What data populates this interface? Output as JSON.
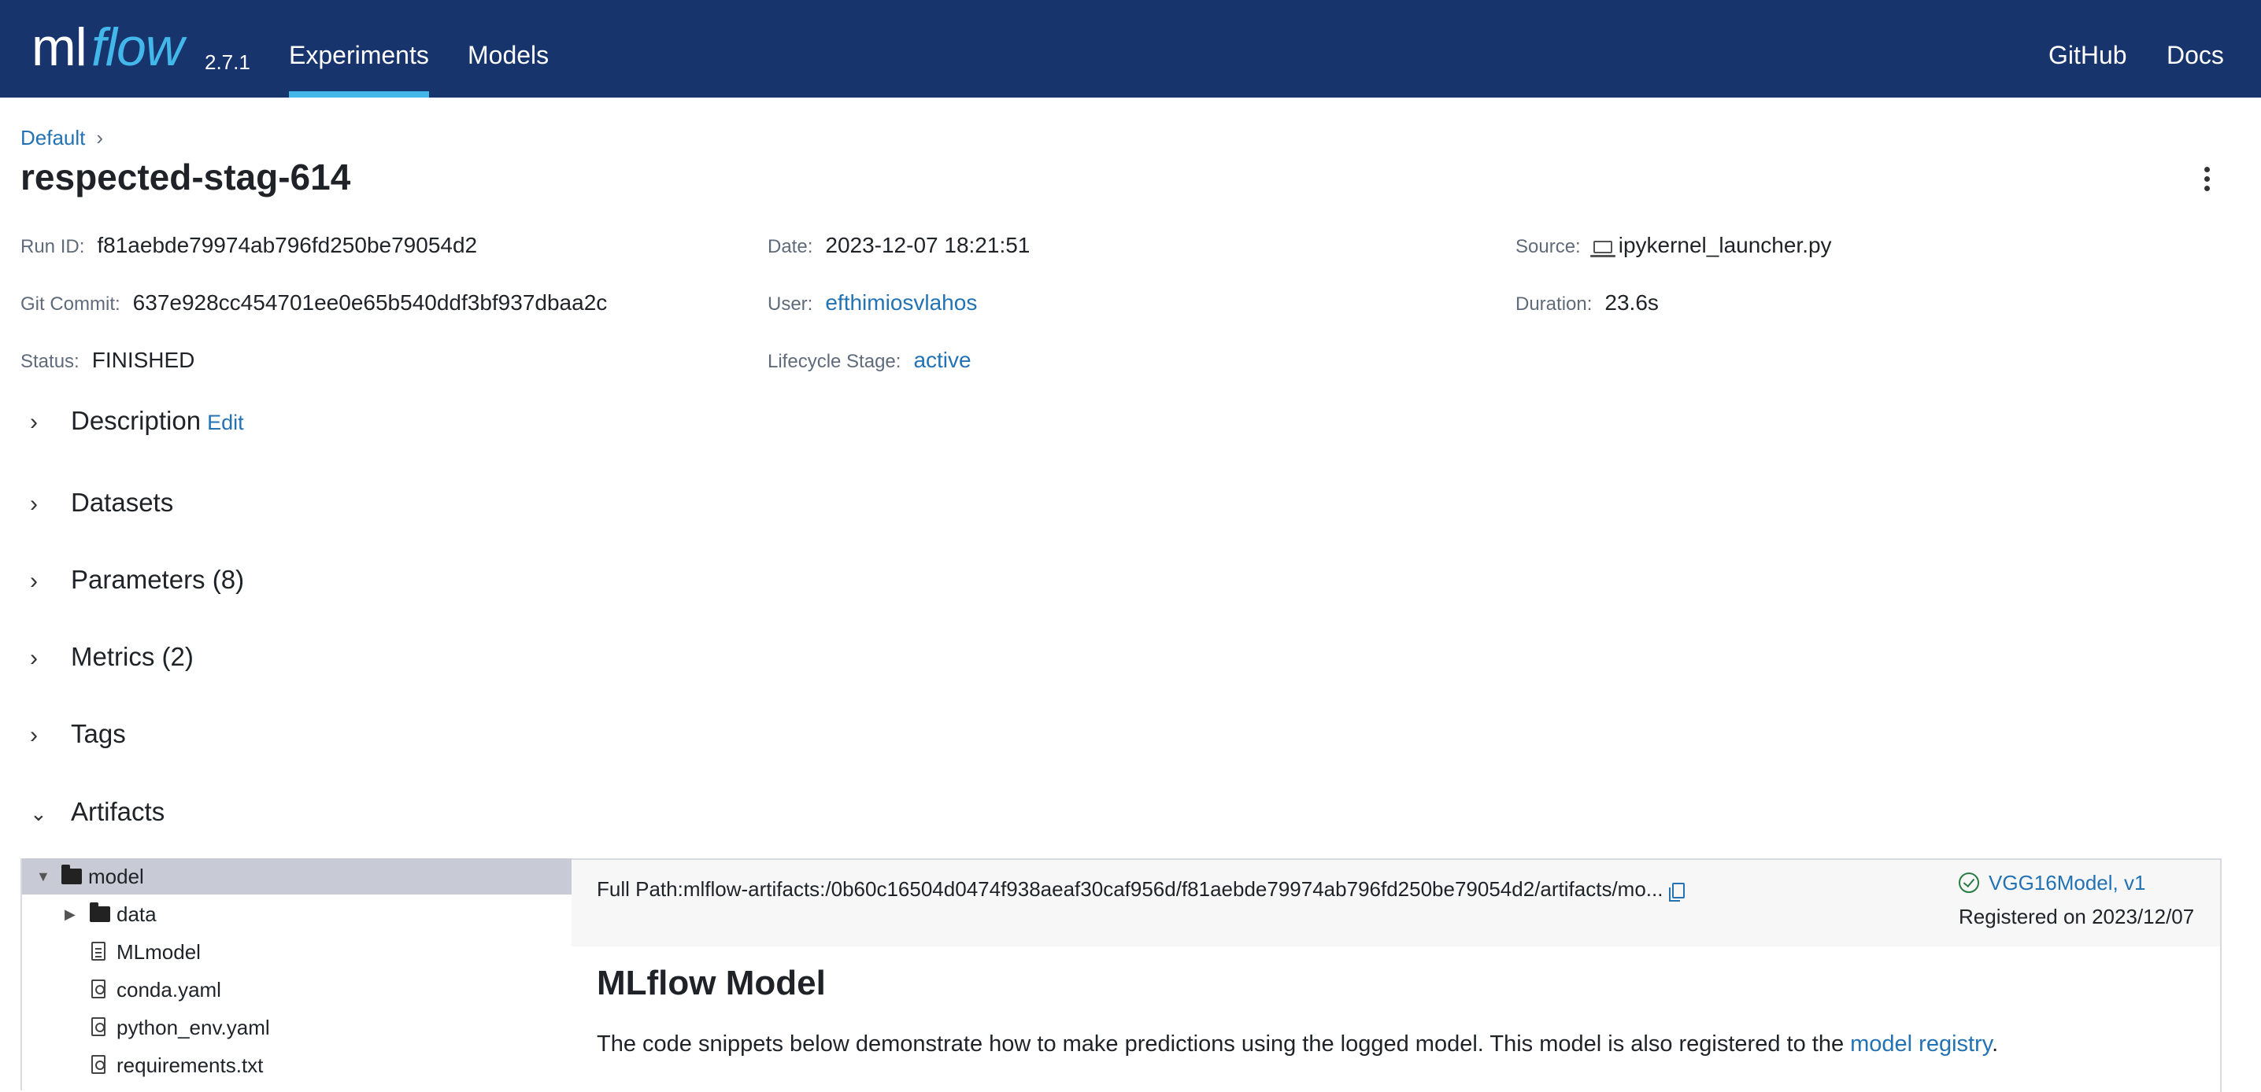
{
  "header": {
    "logo_ml": "ml",
    "logo_flow": "flow",
    "version": "2.7.1",
    "nav": [
      {
        "label": "Experiments",
        "active": true
      },
      {
        "label": "Models",
        "active": false
      }
    ],
    "right_links": [
      "GitHub",
      "Docs"
    ]
  },
  "breadcrumb": {
    "experiment": "Default",
    "separator": "›"
  },
  "run": {
    "title": "respected-stag-614",
    "details": {
      "run_id_label": "Run ID:",
      "run_id": "f81aebde79974ab796fd250be79054d2",
      "date_label": "Date:",
      "date": "2023-12-07 18:21:51",
      "source_label": "Source:",
      "source": "ipykernel_launcher.py",
      "git_commit_label": "Git Commit:",
      "git_commit": "637e928cc454701ee0e65b540ddf3bf937dbaa2c",
      "user_label": "User:",
      "user": "efthimiosvlahos",
      "duration_label": "Duration:",
      "duration": "23.6s",
      "status_label": "Status:",
      "status": "FINISHED",
      "lifecycle_label": "Lifecycle Stage:",
      "lifecycle": "active"
    }
  },
  "sections": [
    {
      "label": "Description",
      "expanded": false,
      "action": "Edit"
    },
    {
      "label": "Datasets",
      "expanded": false
    },
    {
      "label": "Parameters (8)",
      "expanded": false
    },
    {
      "label": "Metrics (2)",
      "expanded": false
    },
    {
      "label": "Tags",
      "expanded": false
    },
    {
      "label": "Artifacts",
      "expanded": true
    }
  ],
  "artifacts": {
    "tree": [
      {
        "name": "model",
        "type": "folder",
        "expanded": true,
        "selected": true
      },
      {
        "name": "data",
        "type": "folder",
        "expanded": false
      },
      {
        "name": "MLmodel",
        "type": "file"
      },
      {
        "name": "conda.yaml",
        "type": "code"
      },
      {
        "name": "python_env.yaml",
        "type": "code"
      },
      {
        "name": "requirements.txt",
        "type": "code"
      }
    ],
    "full_path": "Full Path:mlflow-artifacts:/0b60c16504d0474f938aeaf30caf956d/f81aebde79974ab796fd250be79054d2/artifacts/mo...",
    "registered_model": "VGG16Model, v1",
    "registered_on": "Registered on 2023/12/07",
    "heading": "MLflow Model",
    "description_text": "The code snippets below demonstrate how to make predictions using the logged model. This model is also registered to the ",
    "registry_link": "model registry",
    "description_end": "."
  }
}
